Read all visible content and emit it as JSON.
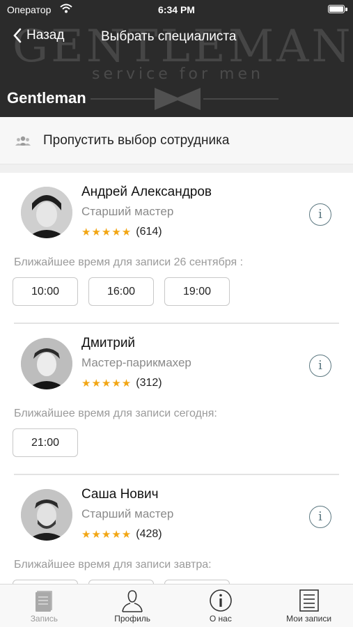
{
  "status_bar": {
    "carrier": "Оператор",
    "time": "6:34 PM"
  },
  "header": {
    "back_label": "Назад",
    "title": "Выбрать специалиста",
    "app_name": "Gentleman",
    "banner_brand": "GENTLEMAN",
    "banner_tagline": "service for men"
  },
  "skip": {
    "label": "Пропустить выбор сотрудника",
    "icon": "group-icon"
  },
  "specialists": [
    {
      "name": "Андрей Александров",
      "role": "Старший мастер",
      "stars": "★★★★★",
      "rating_count": "(614)",
      "slots_label": "Ближайшее время для записи 26 сентября :",
      "slots": [
        "10:00",
        "16:00",
        "19:00"
      ]
    },
    {
      "name": "Дмитрий",
      "role": "Мастер-парикмахер",
      "stars": "★★★★★",
      "rating_count": "(312)",
      "slots_label": "Ближайшее время для записи сегодня:",
      "slots": [
        "21:00"
      ]
    },
    {
      "name": "Саша Нович",
      "role": "Старший мастер",
      "stars": "★★★★★",
      "rating_count": "(428)",
      "slots_label": "Ближайшее время для записи завтра:",
      "slots": [
        "",
        "",
        ""
      ]
    }
  ],
  "tabs": [
    {
      "label": "Запись",
      "icon": "booking-icon",
      "active": false
    },
    {
      "label": "Профиль",
      "icon": "profile-icon",
      "active": true
    },
    {
      "label": "О нас",
      "icon": "info-icon",
      "active": true
    },
    {
      "label": "Мои записи",
      "icon": "my-bookings-icon",
      "active": true
    }
  ],
  "colors": {
    "header_bg": "#2b2b2b",
    "star": "#f2a614",
    "info_icon": "#5b7780"
  }
}
